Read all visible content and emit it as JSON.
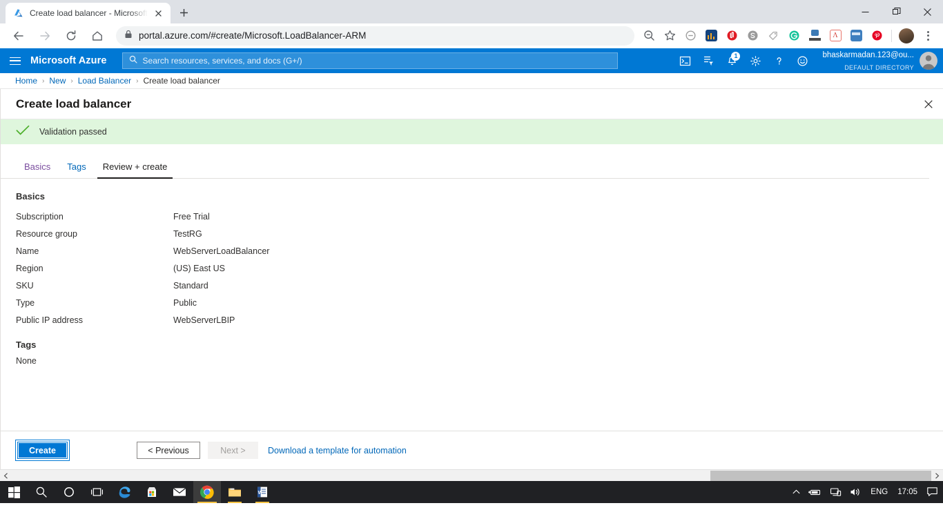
{
  "browser": {
    "tab": {
      "title": "Create load balancer - Microsoft",
      "favicon_icon": "azure-logo-icon",
      "close_icon": "close-icon"
    },
    "new_tab_label": "+",
    "window_controls": {
      "minimize": "minimize-icon",
      "restore": "restore-icon",
      "close": "close-icon"
    },
    "nav": {
      "back": "back-arrow-icon",
      "forward": "forward-arrow-icon",
      "reload": "reload-icon",
      "home": "home-icon"
    },
    "omnibox": {
      "lock_icon": "lock-icon",
      "url": "portal.azure.com/#create/Microsoft.LoadBalancer-ARM"
    },
    "toolbar_icons": [
      {
        "name": "zoom-out-icon",
        "glyph": "⊖"
      },
      {
        "name": "bookmark-star-icon",
        "glyph": "☆"
      },
      {
        "name": "extension-block-icon",
        "color": "#9e9e9e"
      },
      {
        "name": "extension-analytics-icon",
        "color": "#1f4e79"
      },
      {
        "name": "extension-adblock-icon",
        "color": "#e01b24"
      },
      {
        "name": "extension-skype-icon",
        "color": "#8a8a8a"
      },
      {
        "name": "extension-tag-icon",
        "color": "#bdbdbd"
      },
      {
        "name": "extension-grammarly-icon",
        "color": "#15c39a"
      },
      {
        "name": "extension-alexa-icon",
        "color": "#3c7ab5"
      },
      {
        "name": "extension-pdf-icon",
        "color": "#e8746a"
      },
      {
        "name": "extension-screen-icon",
        "color": "#3f7fbf"
      },
      {
        "name": "extension-pinterest-icon",
        "color": "#e60023"
      }
    ],
    "profile_avatar": "profile-avatar",
    "menu_icon": "kebab-menu-icon"
  },
  "azure_bar": {
    "menu_icon": "hamburger-menu-icon",
    "brand": "Microsoft Azure",
    "search": {
      "placeholder": "Search resources, services, and docs (G+/)",
      "icon": "search-icon",
      "value": ""
    },
    "icons": [
      {
        "name": "cloud-shell-icon",
        "badge": ""
      },
      {
        "name": "directory-filter-icon",
        "badge": ""
      },
      {
        "name": "notifications-bell-icon",
        "badge": "1"
      },
      {
        "name": "settings-gear-icon",
        "badge": ""
      },
      {
        "name": "help-icon",
        "badge": ""
      },
      {
        "name": "feedback-smiley-icon",
        "badge": ""
      }
    ],
    "account": {
      "name": "bhaskarmadan.123@ou...",
      "directory": "DEFAULT DIRECTORY",
      "avatar": "user-avatar"
    }
  },
  "breadcrumb": {
    "items": [
      {
        "label": "Home",
        "current": false
      },
      {
        "label": "New",
        "current": false
      },
      {
        "label": "Load Balancer",
        "current": false
      },
      {
        "label": "Create load balancer",
        "current": true
      }
    ],
    "separator": "›"
  },
  "blade": {
    "title": "Create load balancer",
    "close_icon": "close-icon",
    "banner": {
      "icon": "checkmark-icon",
      "text": "Validation passed",
      "background": "#dff6dd",
      "icon_color": "#4caf2a"
    },
    "tabs": [
      {
        "label": "Basics",
        "state": "visited"
      },
      {
        "label": "Tags",
        "state": "link"
      },
      {
        "label": "Review + create",
        "state": "active"
      }
    ],
    "sections": [
      {
        "heading": "Basics",
        "rows": [
          {
            "key": "Subscription",
            "value": "Free Trial"
          },
          {
            "key": "Resource group",
            "value": "TestRG"
          },
          {
            "key": "Name",
            "value": "WebServerLoadBalancer"
          },
          {
            "key": "Region",
            "value": "(US) East US"
          },
          {
            "key": "SKU",
            "value": "Standard"
          },
          {
            "key": "Type",
            "value": "Public"
          },
          {
            "key": "Public IP address",
            "value": "WebServerLBIP"
          }
        ]
      },
      {
        "heading": "Tags",
        "empty_label": "None"
      }
    ],
    "footer": {
      "create_label": "Create",
      "previous_label": "< Previous",
      "next_label": "Next >",
      "download_link": "Download a template for automation"
    },
    "accent_color": "#0078d4",
    "link_color": "#0067b8"
  },
  "taskbar": {
    "items": [
      {
        "name": "start-button-icon",
        "state": ""
      },
      {
        "name": "search-icon",
        "state": ""
      },
      {
        "name": "cortana-icon",
        "state": ""
      },
      {
        "name": "task-view-icon",
        "state": ""
      },
      {
        "name": "edge-icon",
        "state": ""
      },
      {
        "name": "microsoft-store-icon",
        "state": ""
      },
      {
        "name": "mail-icon",
        "state": ""
      },
      {
        "name": "chrome-icon",
        "state": "active"
      },
      {
        "name": "file-explorer-icon",
        "state": "running"
      },
      {
        "name": "word-icon",
        "state": "running"
      }
    ],
    "tray": {
      "show_hidden_icon": "chevron-up-icon",
      "battery_icon": "battery-icon",
      "network_icon": "network-icon",
      "volume_icon": "volume-icon",
      "language": "ENG",
      "time": "17:05",
      "action_center_icon": "action-center-icon"
    }
  }
}
